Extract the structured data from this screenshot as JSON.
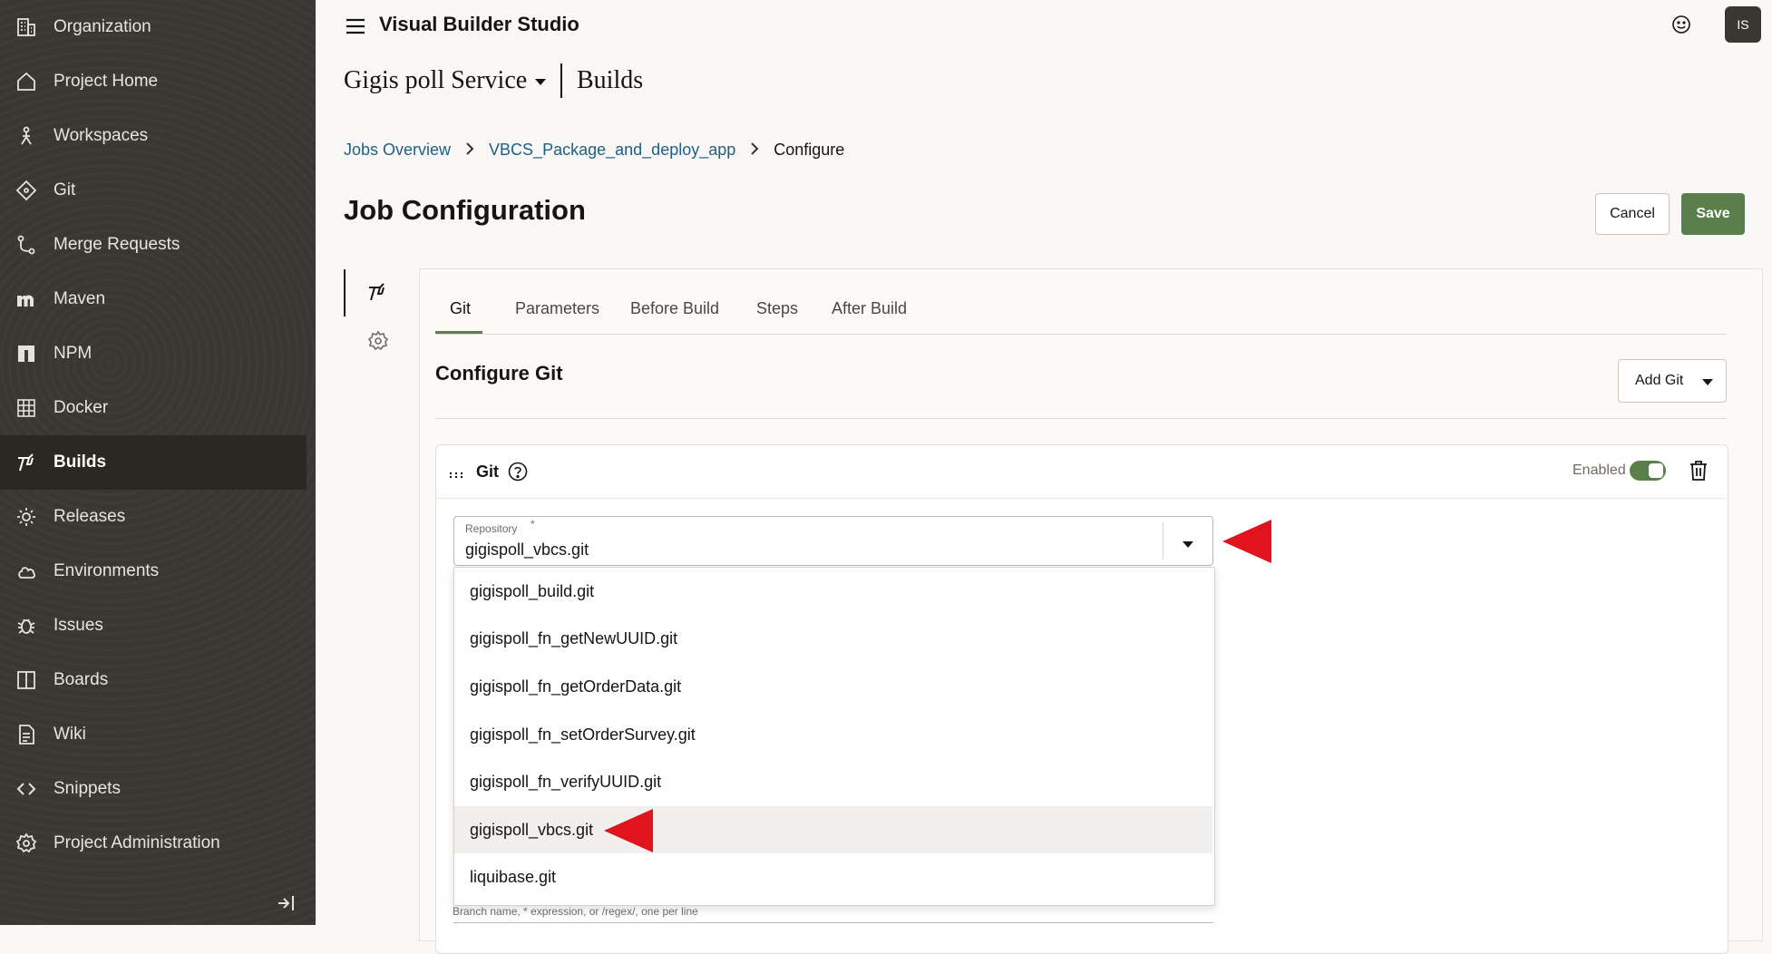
{
  "sidebar": {
    "items": [
      {
        "label": "Organization",
        "icon": "organization-icon"
      },
      {
        "label": "Project Home",
        "icon": "home-icon"
      },
      {
        "label": "Workspaces",
        "icon": "workspaces-icon"
      },
      {
        "label": "Git",
        "icon": "git-icon"
      },
      {
        "label": "Merge Requests",
        "icon": "merge-requests-icon"
      },
      {
        "label": "Maven",
        "icon": "maven-icon"
      },
      {
        "label": "NPM",
        "icon": "npm-icon"
      },
      {
        "label": "Docker",
        "icon": "docker-icon"
      },
      {
        "label": "Builds",
        "icon": "builds-icon",
        "active": true
      },
      {
        "label": "Releases",
        "icon": "releases-icon"
      },
      {
        "label": "Environments",
        "icon": "environments-icon"
      },
      {
        "label": "Issues",
        "icon": "issues-icon"
      },
      {
        "label": "Boards",
        "icon": "boards-icon"
      },
      {
        "label": "Wiki",
        "icon": "wiki-icon"
      },
      {
        "label": "Snippets",
        "icon": "snippets-icon"
      },
      {
        "label": "Project Administration",
        "icon": "project-admin-icon"
      }
    ]
  },
  "header": {
    "app_title": "Visual Builder Studio",
    "avatar_initials": "IS"
  },
  "project": {
    "name": "Gigis poll Service",
    "section": "Builds"
  },
  "breadcrumb": {
    "items": [
      "Jobs Overview",
      "VBCS_Package_and_deploy_app"
    ],
    "current": "Configure"
  },
  "page": {
    "title": "Job Configuration",
    "cancel_label": "Cancel",
    "save_label": "Save"
  },
  "tabs": [
    {
      "label": "Git",
      "active": true
    },
    {
      "label": "Parameters"
    },
    {
      "label": "Before Build"
    },
    {
      "label": "Steps"
    },
    {
      "label": "After Build"
    }
  ],
  "configure_git": {
    "title": "Configure Git",
    "add_git_label": "Add Git",
    "card": {
      "title": "Git",
      "enabled_label": "Enabled",
      "enabled": true,
      "repository": {
        "label": "Repository",
        "required_marker": "*",
        "value": "gigispoll_vbcs.git",
        "options": [
          "gigispoll_build.git",
          "gigispoll_fn_getNewUUID.git",
          "gigispoll_fn_getOrderData.git",
          "gigispoll_fn_setOrderSurvey.git",
          "gigispoll_fn_verifyUUID.git",
          "gigispoll_vbcs.git",
          "liquibase.git"
        ],
        "hovered_option": "gigispoll_vbcs.git"
      },
      "branch_hint": "Branch name, * expression, or /regex/, one per line"
    }
  },
  "colors": {
    "sidebar_bg": "#3a3631",
    "accent_green": "#5b7f4b",
    "link_blue": "#1e5f86",
    "annotation_red": "#e0141e"
  }
}
